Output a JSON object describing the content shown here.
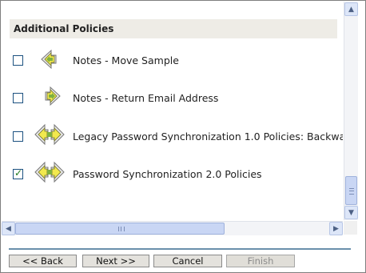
{
  "section_title": "Additional Policies",
  "policies": [
    {
      "label": "Notes - Move Sample",
      "checked": false,
      "icon": "policy-left-arrow-icon"
    },
    {
      "label": "Notes - Return Email Address",
      "checked": false,
      "icon": "policy-right-arrow-icon"
    },
    {
      "label": "Legacy Password Synchronization 1.0 Policies: Backwa",
      "checked": false,
      "icon": "policy-bidirectional-icon"
    },
    {
      "label": "Password Synchronization 2.0 Policies",
      "checked": true,
      "icon": "policy-bidirectional-icon"
    }
  ],
  "scrollbars": {
    "vertical_up_glyph": "▲",
    "vertical_down_glyph": "▼",
    "horizontal_left_glyph": "◀",
    "horizontal_right_glyph": "▶"
  },
  "buttons": {
    "back": "<< Back",
    "next": "Next >>",
    "cancel": "Cancel",
    "finish": "Finish"
  },
  "colors": {
    "header_bg": "#eeece6",
    "checkbox_border": "#1c5180",
    "checkmark": "#1f7a1f",
    "icon_yellow": "#f2e94e",
    "icon_green": "#7fb040"
  }
}
